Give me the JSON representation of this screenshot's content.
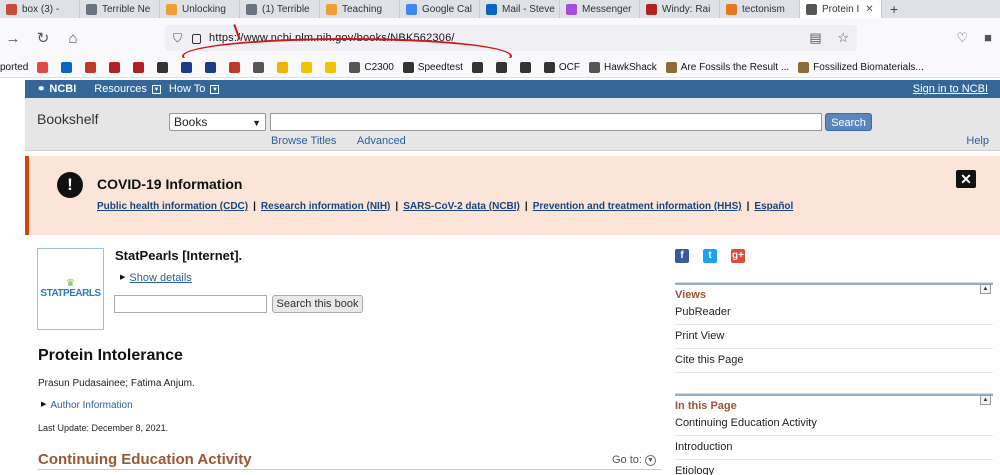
{
  "browser": {
    "tabs": [
      {
        "label": "box (3) -",
        "color": "#c94a3a",
        "active": false
      },
      {
        "label": "Terrible Ne",
        "color": "#6b7280",
        "active": false
      },
      {
        "label": "Unlocking",
        "color": "#f0a030",
        "active": false
      },
      {
        "label": "(1) Terrible",
        "color": "#6b7280",
        "active": false
      },
      {
        "label": "Teaching",
        "color": "#f0a030",
        "active": false
      },
      {
        "label": "Google Cal",
        "color": "#4285f4",
        "active": false
      },
      {
        "label": "Mail - Steve",
        "color": "#0a64c4",
        "active": false
      },
      {
        "label": "Messenger",
        "color": "#a04de0",
        "active": false
      },
      {
        "label": "Windy: Rai",
        "color": "#b22222",
        "active": false
      },
      {
        "label": "tectonism",
        "color": "#e87a1e",
        "active": false
      },
      {
        "label": "Protein I",
        "color": "#555555",
        "active": true
      }
    ],
    "new_tab": "+",
    "tab_close": "✕",
    "url": "https://www.ncbi.nlm.nih.gov/books/NBK562306/",
    "bookmarks": [
      {
        "label": "ported",
        "color": "#ffffff"
      },
      {
        "label": "",
        "color": "#e04848"
      },
      {
        "label": "",
        "color": "#0a64c4"
      },
      {
        "label": "",
        "color": "#c0392b"
      },
      {
        "label": "",
        "color": "#b22222"
      },
      {
        "label": "",
        "color": "#b02020"
      },
      {
        "label": "",
        "color": "#333333"
      },
      {
        "label": "",
        "color": "#1b3b8a"
      },
      {
        "label": "",
        "color": "#1b3b8a"
      },
      {
        "label": "",
        "color": "#c0392b"
      },
      {
        "label": "",
        "color": "#555555"
      },
      {
        "label": "",
        "color": "#f0b400"
      },
      {
        "label": "",
        "color": "#f0c400"
      },
      {
        "label": "",
        "color": "#f0c400"
      },
      {
        "label": "C2300",
        "color": "#555555"
      },
      {
        "label": "Speedtest",
        "color": "#333333"
      },
      {
        "label": "",
        "color": "#333333"
      },
      {
        "label": "",
        "color": "#333333"
      },
      {
        "label": "",
        "color": "#333333"
      },
      {
        "label": "OCF",
        "color": "#333333"
      },
      {
        "label": "HawkShack",
        "color": "#555555"
      },
      {
        "label": "Are Fossils the Result ...",
        "color": "#8a6d3b"
      },
      {
        "label": "Fossilized Biomaterials...",
        "color": "#8a6d3b"
      }
    ]
  },
  "ncbi": {
    "logo": "NCBI",
    "resources": "Resources",
    "how_to": "How To",
    "sign_in": "Sign in to NCBI"
  },
  "bookshelf": {
    "title": "Bookshelf",
    "db_select": "Books",
    "search_button": "Search",
    "browse_titles": "Browse Titles",
    "advanced": "Advanced",
    "help": "Help"
  },
  "covid": {
    "title": "COVID-19 Information",
    "links": [
      "Public health information (CDC)",
      "Research information (NIH)",
      "SARS-CoV-2 data (NCBI)",
      "Prevention and treatment information (HHS)",
      "Español"
    ],
    "separator": "|"
  },
  "book": {
    "cover_text": "STATPEARLS",
    "title": "StatPearls [Internet].",
    "show_details": "Show details",
    "search_button": "Search this book"
  },
  "article": {
    "title": "Protein Intolerance",
    "authors": "Prasun Pudasainee; Fatima Anjum.",
    "author_info": "Author Information",
    "last_update": "Last Update: December 8, 2021.",
    "section_heading": "Continuing Education Activity",
    "go_to": "Go to:"
  },
  "sidebar": {
    "social": [
      {
        "name": "facebook-icon",
        "glyph": "f",
        "color": "#3b5998"
      },
      {
        "name": "twitter-icon",
        "glyph": "t",
        "color": "#1da1f2"
      },
      {
        "name": "google-plus-icon",
        "glyph": "g+",
        "color": "#dd4b39"
      }
    ],
    "views": {
      "title": "Views",
      "items": [
        "PubReader",
        "Print View",
        "Cite this Page"
      ]
    },
    "in_this_page": {
      "title": "In this Page",
      "items": [
        "Continuing Education Activity",
        "Introduction",
        "Etiology"
      ]
    }
  }
}
